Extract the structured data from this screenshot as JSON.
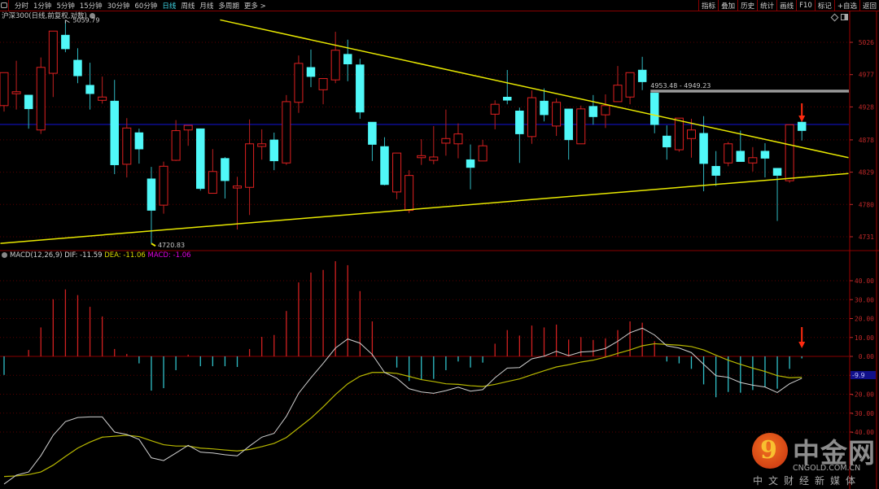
{
  "toolbar": {
    "periods": [
      "分时",
      "1分钟",
      "5分钟",
      "15分钟",
      "30分钟",
      "60分钟",
      "日线",
      "周线",
      "月线",
      "多周期",
      "更多 >"
    ],
    "active_period": "日线",
    "actions": [
      "指标",
      "叠加",
      "历史",
      "统计",
      "画线",
      "F10",
      "标记",
      "+自选",
      "返回"
    ]
  },
  "chart_title": "沪深300(日线,前复权,对数)",
  "macd_header": {
    "label": "MACD(12,26,9)",
    "dif": "DIF: -11.59",
    "dea": "DEA: -11.06",
    "macd": "MACD: -1.06"
  },
  "watermark": {
    "cn": "中金网",
    "en": "CNGOLD.COM.CN",
    "sub": "中文财经新媒体",
    "glyph": "9"
  },
  "colors": {
    "up": "#e02020",
    "down": "#50f8f8",
    "trend": "#e8e800",
    "ref_line": "#1010c0",
    "dif": "#d0d0d0",
    "dea": "#b8b800",
    "axis": "#c02828"
  },
  "chart_data": [
    {
      "type": "candlestick",
      "title": "沪深300(日线,前复权,对数)",
      "y_ticks": [
        "5026",
        "4977",
        "4928",
        "4878",
        "4829",
        "4780",
        "4731"
      ],
      "ylim": [
        4710,
        5080
      ],
      "high_label": "5059.79",
      "low_label": "4720.83",
      "gap_label": "4953.48 - 4949.23",
      "gap": [
        4953.48,
        4949.23
      ],
      "reference_line": 4901.4,
      "ohlc": [
        [
          4930,
          4980,
          4921,
          4980
        ],
        [
          4948,
          4998,
          4924,
          4951
        ],
        [
          4946,
          4946,
          4895,
          4925
        ],
        [
          4893,
          5003,
          4887,
          4988
        ],
        [
          4979,
          5043,
          4943,
          5043
        ],
        [
          5037,
          5059.79,
          5011,
          5016
        ],
        [
          4999,
          5017,
          4964,
          4975
        ],
        [
          4961,
          4995,
          4924,
          4948
        ],
        [
          4938,
          4974,
          4933,
          4943
        ],
        [
          4937,
          4969,
          4826,
          4840
        ],
        [
          4841,
          4911,
          4821,
          4896
        ],
        [
          4889,
          4895,
          4842,
          4864
        ],
        [
          4819,
          4837,
          4720.83,
          4771
        ],
        [
          4779,
          4845,
          4766,
          4838
        ],
        [
          4847,
          4908,
          4846,
          4892
        ],
        [
          4893,
          4900,
          4869,
          4900
        ],
        [
          4895,
          4895,
          4801,
          4804
        ],
        [
          4797,
          4864,
          4797,
          4830
        ],
        [
          4850,
          4852,
          4789,
          4816
        ],
        [
          4805,
          4822,
          4742,
          4808
        ],
        [
          4806,
          4909,
          4764,
          4872
        ],
        [
          4868,
          4894,
          4848,
          4872
        ],
        [
          4878,
          4889,
          4832,
          4846
        ],
        [
          4843,
          4946,
          4840,
          4936
        ],
        [
          4935,
          5006,
          4919,
          4994
        ],
        [
          4988,
          5015,
          4958,
          4974
        ],
        [
          4954,
          4971,
          4932,
          4971
        ],
        [
          4969,
          5042,
          4964,
          5014
        ],
        [
          5008,
          5030,
          4967,
          4993
        ],
        [
          4992,
          5001,
          4910,
          4920
        ],
        [
          4905,
          4905,
          4846,
          4871
        ],
        [
          4868,
          4882,
          4809,
          4810
        ],
        [
          4799,
          4858,
          4788,
          4858
        ],
        [
          4771,
          4832,
          4767,
          4824
        ],
        [
          4851,
          4879,
          4840,
          4854
        ],
        [
          4847,
          4899,
          4841,
          4852
        ],
        [
          4873,
          4924,
          4854,
          4880
        ],
        [
          4872,
          4903,
          4850,
          4887
        ],
        [
          4848,
          4871,
          4803,
          4836
        ],
        [
          4846,
          4878,
          4846,
          4869
        ],
        [
          4917,
          4938,
          4894,
          4932
        ],
        [
          4943,
          4984,
          4932,
          4938
        ],
        [
          4922,
          4927,
          4843,
          4887
        ],
        [
          4883,
          4953,
          4872,
          4942
        ],
        [
          4937,
          4956,
          4906,
          4916
        ],
        [
          4899,
          4941,
          4884,
          4935
        ],
        [
          4925,
          4925,
          4848,
          4878
        ],
        [
          4872,
          4930,
          4872,
          4925
        ],
        [
          4929,
          4946,
          4901,
          4913
        ],
        [
          4916,
          4947,
          4896,
          4930
        ],
        [
          4936,
          4990,
          4936,
          4961
        ],
        [
          4943,
          4980,
          4932,
          4980
        ],
        [
          4984,
          5004,
          4953.48,
          4966
        ],
        [
          4949.23,
          4949.23,
          4888,
          4901
        ],
        [
          4884,
          4900,
          4848,
          4867
        ],
        [
          4863,
          4911,
          4860,
          4911
        ],
        [
          4880,
          4910,
          4851,
          4893
        ],
        [
          4888,
          4914,
          4800,
          4842
        ],
        [
          4838,
          4861,
          4808,
          4824
        ],
        [
          4843,
          4875,
          4838,
          4872
        ],
        [
          4861,
          4892,
          4845,
          4845
        ],
        [
          4843,
          4867,
          4830,
          4851
        ],
        [
          4861,
          4873,
          4821,
          4850
        ],
        [
          4835,
          4835,
          4755,
          4824
        ],
        [
          4816,
          4901,
          4813,
          4901
        ],
        [
          4905,
          4933,
          4877,
          4892
        ]
      ],
      "trendlines": [
        {
          "name": "resistance",
          "from": [
            17.6,
            5060
          ],
          "to": [
            68.8,
            4851
          ]
        },
        {
          "name": "support",
          "from": [
            -0.3,
            4721
          ],
          "to": [
            68.8,
            4827
          ]
        }
      ],
      "marker": {
        "type": "arrow-down",
        "index": 65
      }
    },
    {
      "type": "macd",
      "y_ticks": [
        "40.00",
        "30.00",
        "20.00",
        "10.00",
        "0.00",
        "-10.00",
        "-20.00",
        "-30.00",
        "-40.00"
      ],
      "ylim": [
        -70,
        52
      ],
      "current_label": "-9.9",
      "histogram": [
        -9.8,
        0,
        3.4,
        15.3,
        30.2,
        35.4,
        32.4,
        26.2,
        21.1,
        3.9,
        1.3,
        -3.7,
        -18.1,
        -16.8,
        -7.3,
        0.9,
        -5.2,
        -5.2,
        -5.2,
        -5.6,
        3.9,
        10.3,
        11.3,
        24.0,
        39.1,
        44.3,
        45.7,
        50.3,
        48.2,
        34.5,
        18.5,
        0,
        -5.9,
        -13.0,
        -12.3,
        -11.9,
        -7.3,
        -2.7,
        -5.9,
        -3.3,
        6.7,
        13.9,
        11.0,
        16.3,
        15.3,
        16.8,
        8.9,
        10.2,
        8.7,
        9.5,
        13.9,
        18.5,
        17.8,
        8.0,
        -2.7,
        -3.7,
        -6.6,
        -14.8,
        -21.6,
        -18.8,
        -19.2,
        -17.8,
        -16.3,
        -17.1,
        -6.6,
        -1.06
      ],
      "dif": [
        -67.5,
        -62.8,
        -61.1,
        -52.5,
        -41.7,
        -34.5,
        -32.3,
        -32.0,
        -32.0,
        -40.0,
        -41.3,
        -43.9,
        -53.6,
        -55.1,
        -51.1,
        -47.0,
        -50.6,
        -51.1,
        -52.0,
        -52.6,
        -47.4,
        -42.7,
        -40.7,
        -31.7,
        -19.5,
        -11.3,
        -3.7,
        4.4,
        9.2,
        7.0,
        1.0,
        -8.5,
        -11.6,
        -17.1,
        -18.8,
        -19.5,
        -18.1,
        -16.3,
        -18.4,
        -17.6,
        -11.3,
        -6.2,
        -5.9,
        -1.3,
        0.1,
        2.7,
        0.4,
        2.3,
        2.7,
        4.2,
        8.0,
        12.5,
        14.9,
        11.3,
        5.6,
        4.4,
        2.0,
        -4.2,
        -10.2,
        -11.1,
        -13.8,
        -15.2,
        -16.2,
        -19.1,
        -14.5,
        -11.59
      ],
      "dea": [
        -63.5,
        -63.2,
        -62.5,
        -61.1,
        -57.5,
        -52.9,
        -48.5,
        -45.3,
        -42.7,
        -42.2,
        -41.7,
        -42.4,
        -44.6,
        -46.7,
        -47.4,
        -47.4,
        -48.5,
        -48.9,
        -49.5,
        -50.0,
        -49.2,
        -47.7,
        -46.0,
        -42.9,
        -37.8,
        -32.7,
        -26.7,
        -20.2,
        -14.5,
        -10.5,
        -8.5,
        -8.5,
        -9.0,
        -10.6,
        -12.3,
        -13.3,
        -14.5,
        -14.8,
        -15.5,
        -15.9,
        -14.8,
        -13.3,
        -11.9,
        -9.7,
        -7.6,
        -5.6,
        -4.4,
        -3.0,
        -2.0,
        -0.4,
        1.6,
        3.4,
        5.6,
        6.7,
        6.3,
        5.9,
        5.2,
        3.4,
        0.6,
        -2.0,
        -4.2,
        -6.2,
        -8.0,
        -10.2,
        -11.3,
        -11.06
      ],
      "marker": {
        "type": "arrow-down",
        "index": 65
      }
    }
  ]
}
